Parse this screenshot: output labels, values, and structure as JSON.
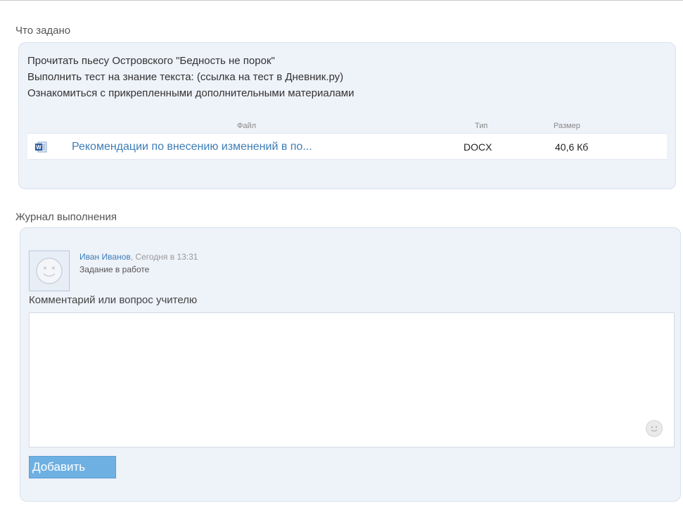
{
  "task": {
    "section_title": "Что задано",
    "lines": [
      "Прочитать пьесу Островского \"Бедность не порок\"",
      "Выполнить тест на знание текста: (ссылка на тест в Дневник.ру)",
      "Ознакомиться с прикрепленными дополнительными материалами"
    ],
    "files_table": {
      "headers": {
        "file": "Файл",
        "type": "Тип",
        "size": "Размер"
      },
      "rows": [
        {
          "icon": "word-document-icon",
          "name": "Рекомендации по внесению изменений в по...",
          "type": "DOCX",
          "size": "40,6 Кб"
        }
      ]
    }
  },
  "log": {
    "section_title": "Журнал выполнения",
    "entry": {
      "avatar_icon": "smiley-avatar-icon",
      "author": "Иван Иванов",
      "separator": ",",
      "time": "Сегодня в 13:31",
      "status": "Задание в работе"
    },
    "comment_label": "Комментарий или вопрос учителю",
    "comment_value": "",
    "emoji_icon": "smiley-icon",
    "add_button": "Добавить"
  },
  "colors": {
    "link": "#3d7db6",
    "card_bg": "#eef2f9",
    "button_bg": "#6fb0e3"
  }
}
